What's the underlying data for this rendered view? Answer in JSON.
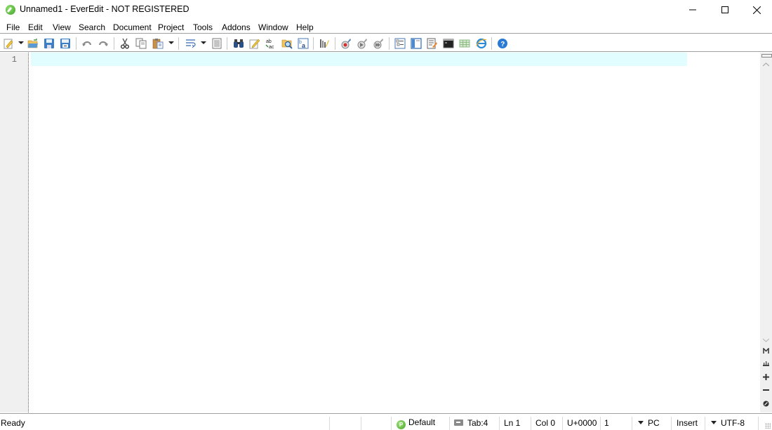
{
  "window": {
    "title": "Unnamed1 - EverEdit - NOT REGISTERED",
    "controls": [
      "minimize",
      "maximize",
      "close"
    ]
  },
  "menu": {
    "items": [
      {
        "label": "File"
      },
      {
        "label": "Edit"
      },
      {
        "label": "View"
      },
      {
        "label": "Search"
      },
      {
        "label": "Document"
      },
      {
        "label": "Project"
      },
      {
        "label": "Tools"
      },
      {
        "label": "Addons"
      },
      {
        "label": "Window"
      },
      {
        "label": "Help"
      }
    ]
  },
  "toolbar": {
    "buttons": [
      {
        "icon": "new-file-icon"
      },
      {
        "icon": "open-folder-icon"
      },
      {
        "icon": "save-icon"
      },
      {
        "icon": "save-all-icon"
      },
      {
        "icon": "undo-icon"
      },
      {
        "icon": "redo-icon"
      },
      {
        "icon": "cut-icon"
      },
      {
        "icon": "copy-icon"
      },
      {
        "icon": "paste-icon"
      },
      {
        "icon": "word-wrap-icon",
        "active": true
      },
      {
        "icon": "document-view-icon"
      },
      {
        "icon": "find-icon"
      },
      {
        "icon": "edit-pencil-icon"
      },
      {
        "icon": "replace-icon"
      },
      {
        "icon": "find-in-files-icon"
      },
      {
        "icon": "replace-in-files-icon"
      },
      {
        "icon": "column-mode-icon"
      },
      {
        "icon": "record-macro-icon"
      },
      {
        "icon": "play-macro-icon"
      },
      {
        "icon": "play-macro-multiple-icon"
      },
      {
        "icon": "outline-icon"
      },
      {
        "icon": "sidebar-panel-icon"
      },
      {
        "icon": "notes-icon"
      },
      {
        "icon": "console-icon"
      },
      {
        "icon": "grid-icon"
      },
      {
        "icon": "browser-icon"
      },
      {
        "icon": "help-icon"
      }
    ]
  },
  "editor": {
    "line_numbers": [
      "1"
    ],
    "content": "",
    "current_line_color": "#e2fdff"
  },
  "scrollbar": {
    "icons": [
      "scroll-down-icon",
      "bookmark-m-icon",
      "crown-icon",
      "zoom-in-icon",
      "zoom-out-icon",
      "reset-zoom-icon"
    ]
  },
  "status": {
    "ready": "Ready",
    "syntax": "Default",
    "syntax_badge": "P",
    "tab": "Tab:4",
    "line": "Ln 1",
    "col": "Col 0",
    "unicode": "U+0000",
    "selection": "1",
    "line_ending": "PC",
    "mode": "Insert",
    "encoding": "UTF-8"
  }
}
